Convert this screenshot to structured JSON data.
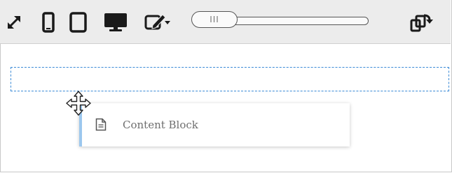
{
  "toolbar": {
    "buttons": [
      {
        "icon": "expand-icon"
      },
      {
        "icon": "mobile-icon"
      },
      {
        "icon": "tablet-icon"
      },
      {
        "icon": "desktop-icon"
      },
      {
        "icon": "edit-dropdown-icon"
      },
      {
        "icon": "swap-layout-icon"
      }
    ],
    "slider": {
      "thumb_label": "III"
    },
    "accent_color": "#1a1a1a"
  },
  "canvas": {
    "drop_zone_color": "#3a8ad6",
    "content_block": {
      "label": "Content Block",
      "icon": "document-icon",
      "accent_color": "#9cc7ee"
    },
    "cursor": "move-cursor-icon"
  }
}
